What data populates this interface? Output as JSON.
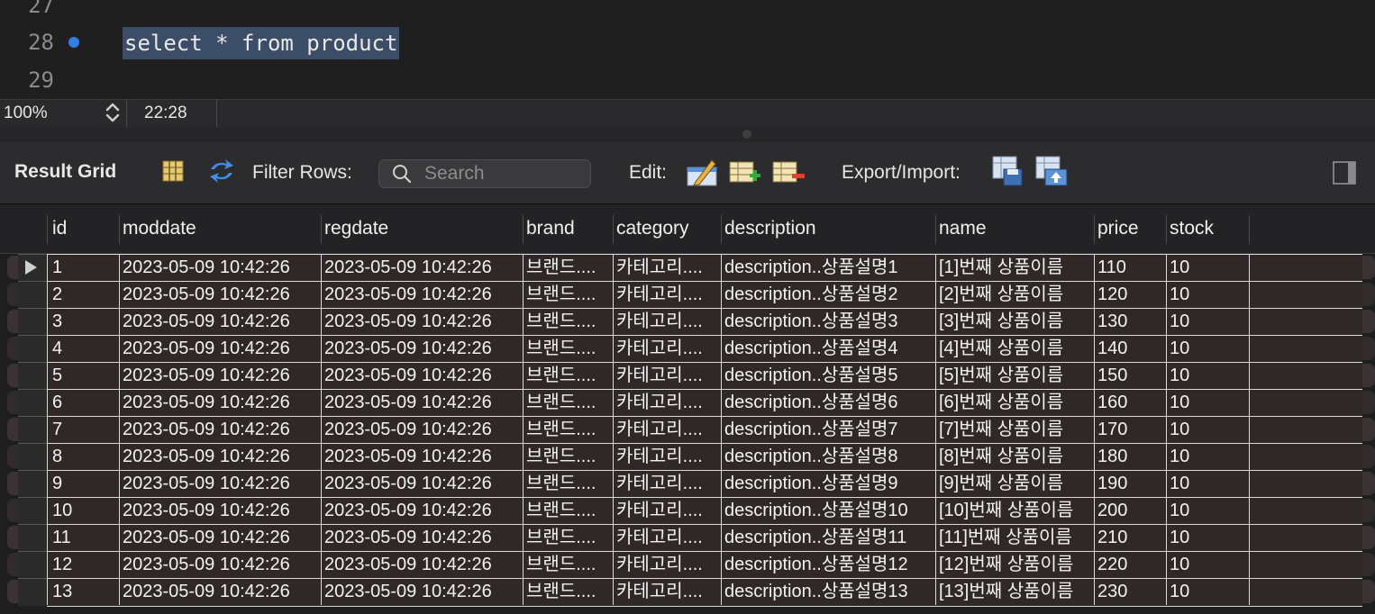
{
  "editor": {
    "lines": [
      {
        "num": "27",
        "code": ""
      },
      {
        "num": "28",
        "code": "select * from product"
      },
      {
        "num": "29",
        "code": ""
      }
    ]
  },
  "status": {
    "zoom": "100%",
    "cursor": "22:28"
  },
  "toolbar": {
    "title": "Result Grid",
    "filter_label": "Filter Rows:",
    "search_placeholder": "Search",
    "edit_label": "Edit:",
    "export_label": "Export/Import:"
  },
  "grid": {
    "columns": [
      "id",
      "moddate",
      "regdate",
      "brand",
      "category",
      "description",
      "name",
      "price",
      "stock"
    ],
    "rows": [
      [
        "1",
        "2023-05-09 10:42:26",
        "2023-05-09 10:42:26",
        "브랜드....",
        "카테고리....",
        "description..상품설명1",
        "[1]번째 상품이름",
        "110",
        "10"
      ],
      [
        "2",
        "2023-05-09 10:42:26",
        "2023-05-09 10:42:26",
        "브랜드....",
        "카테고리....",
        "description..상품설명2",
        "[2]번째 상품이름",
        "120",
        "10"
      ],
      [
        "3",
        "2023-05-09 10:42:26",
        "2023-05-09 10:42:26",
        "브랜드....",
        "카테고리....",
        "description..상품설명3",
        "[3]번째 상품이름",
        "130",
        "10"
      ],
      [
        "4",
        "2023-05-09 10:42:26",
        "2023-05-09 10:42:26",
        "브랜드....",
        "카테고리....",
        "description..상품설명4",
        "[4]번째 상품이름",
        "140",
        "10"
      ],
      [
        "5",
        "2023-05-09 10:42:26",
        "2023-05-09 10:42:26",
        "브랜드....",
        "카테고리....",
        "description..상품설명5",
        "[5]번째 상품이름",
        "150",
        "10"
      ],
      [
        "6",
        "2023-05-09 10:42:26",
        "2023-05-09 10:42:26",
        "브랜드....",
        "카테고리....",
        "description..상품설명6",
        "[6]번째 상품이름",
        "160",
        "10"
      ],
      [
        "7",
        "2023-05-09 10:42:26",
        "2023-05-09 10:42:26",
        "브랜드....",
        "카테고리....",
        "description..상품설명7",
        "[7]번째 상품이름",
        "170",
        "10"
      ],
      [
        "8",
        "2023-05-09 10:42:26",
        "2023-05-09 10:42:26",
        "브랜드....",
        "카테고리....",
        "description..상품설명8",
        "[8]번째 상품이름",
        "180",
        "10"
      ],
      [
        "9",
        "2023-05-09 10:42:26",
        "2023-05-09 10:42:26",
        "브랜드....",
        "카테고리....",
        "description..상품설명9",
        "[9]번째 상품이름",
        "190",
        "10"
      ],
      [
        "10",
        "2023-05-09 10:42:26",
        "2023-05-09 10:42:26",
        "브랜드....",
        "카테고리....",
        "description..상품설명10",
        "[10]번째 상품이름",
        "200",
        "10"
      ],
      [
        "11",
        "2023-05-09 10:42:26",
        "2023-05-09 10:42:26",
        "브랜드....",
        "카테고리....",
        "description..상품설명11",
        "[11]번째 상품이름",
        "210",
        "10"
      ],
      [
        "12",
        "2023-05-09 10:42:26",
        "2023-05-09 10:42:26",
        "브랜드....",
        "카테고리....",
        "description..상품설명12",
        "[12]번째 상품이름",
        "220",
        "10"
      ],
      [
        "13",
        "2023-05-09 10:42:26",
        "2023-05-09 10:42:26",
        "브랜드....",
        "카테고리....",
        "description..상품설명13",
        "[13]번째 상품이름",
        "230",
        "10"
      ]
    ]
  }
}
